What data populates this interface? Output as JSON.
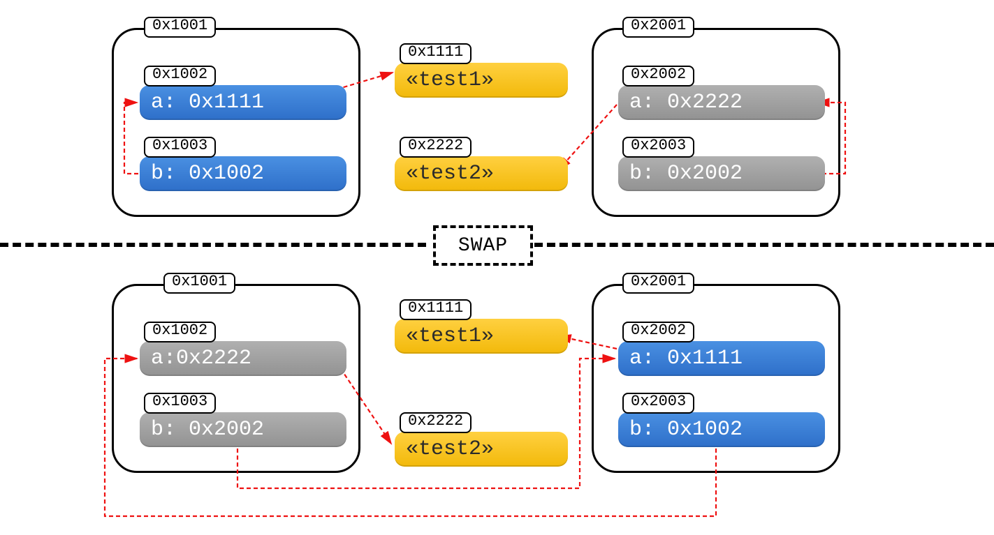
{
  "swap_label": "SWAP",
  "top": {
    "left_container": {
      "addr": "0x1001",
      "a": {
        "addr": "0x1002",
        "label": "a: 0x1111"
      },
      "b": {
        "addr": "0x1003",
        "label": "b: 0x1002"
      }
    },
    "heap1": {
      "addr": "0x1111",
      "label": "«test1»"
    },
    "heap2": {
      "addr": "0x2222",
      "label": "«test2»"
    },
    "right_container": {
      "addr": "0x2001",
      "a": {
        "addr": "0x2002",
        "label": "a: 0x2222"
      },
      "b": {
        "addr": "0x2003",
        "label": "b: 0x2002"
      }
    }
  },
  "bottom": {
    "left_container": {
      "addr": "0x1001",
      "a": {
        "addr": "0x1002",
        "label": "a:0x2222"
      },
      "b": {
        "addr": "0x1003",
        "label": "b: 0x2002"
      }
    },
    "heap1": {
      "addr": "0x1111",
      "label": "«test1»"
    },
    "heap2": {
      "addr": "0x2222",
      "label": "«test2»"
    },
    "right_container": {
      "addr": "0x2001",
      "a": {
        "addr": "0x2002",
        "label": "a: 0x1111"
      },
      "b": {
        "addr": "0x2003",
        "label": "b: 0x1002"
      }
    }
  }
}
